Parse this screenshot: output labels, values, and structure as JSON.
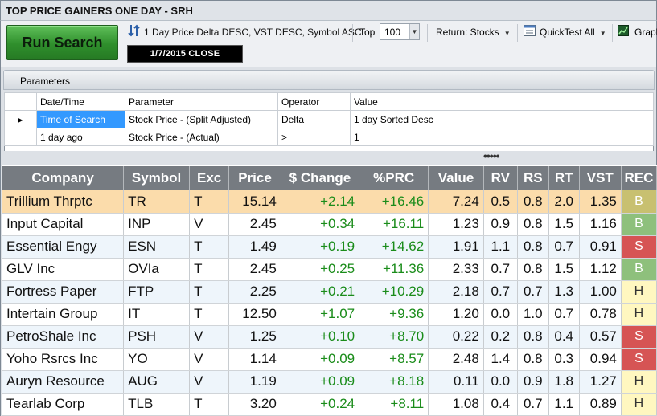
{
  "window": {
    "title": "TOP PRICE GAINERS ONE DAY - SRH"
  },
  "toolbar": {
    "run_label": "Run Search",
    "sort_label": "1 Day Price Delta DESC, VST DESC, Symbol ASC",
    "top_label": "Top",
    "top_value": "100",
    "return_label": "Return: Stocks",
    "quicktest_label": "QuickTest All",
    "graph_label": "Graph",
    "date_label": "1/7/2015  CLOSE"
  },
  "parameters": {
    "title": "Parameters",
    "columns": [
      "Date/Time",
      "Parameter",
      "Operator",
      "Value"
    ],
    "rows": [
      {
        "datetime": "Time of Search",
        "parameter": "Stock Price - (Split Adjusted)",
        "operator": "Delta",
        "value": "1 day Sorted Desc"
      },
      {
        "datetime": "1 day ago",
        "parameter": "Stock Price - (Actual)",
        "operator": ">",
        "value": "1"
      }
    ]
  },
  "splitter": "•••••",
  "results": {
    "columns": [
      "Company",
      "Symbol",
      "Exc",
      "Price",
      "$ Change",
      "%PRC",
      "Value",
      "RV",
      "RS",
      "RT",
      "VST",
      "REC"
    ],
    "rows": [
      {
        "company": "Trillium Thrptc",
        "symbol": "TR",
        "exc": "T",
        "price": "15.14",
        "change": "+2.14",
        "prc": "+16.46",
        "value": "7.24",
        "rv": "0.5",
        "rs": "0.8",
        "rt": "2.0",
        "vst": "1.35",
        "rec": "B"
      },
      {
        "company": "Input Capital",
        "symbol": "INP",
        "exc": "V",
        "price": "2.45",
        "change": "+0.34",
        "prc": "+16.11",
        "value": "1.23",
        "rv": "0.9",
        "rs": "0.8",
        "rt": "1.5",
        "vst": "1.16",
        "rec": "B"
      },
      {
        "company": "Essential Engy",
        "symbol": "ESN",
        "exc": "T",
        "price": "1.49",
        "change": "+0.19",
        "prc": "+14.62",
        "value": "1.91",
        "rv": "1.1",
        "rs": "0.8",
        "rt": "0.7",
        "vst": "0.91",
        "rec": "S"
      },
      {
        "company": "GLV Inc",
        "symbol": "OVIa",
        "exc": "T",
        "price": "2.45",
        "change": "+0.25",
        "prc": "+11.36",
        "value": "2.33",
        "rv": "0.7",
        "rs": "0.8",
        "rt": "1.5",
        "vst": "1.12",
        "rec": "B"
      },
      {
        "company": "Fortress Paper",
        "symbol": "FTP",
        "exc": "T",
        "price": "2.25",
        "change": "+0.21",
        "prc": "+10.29",
        "value": "2.18",
        "rv": "0.7",
        "rs": "0.7",
        "rt": "1.3",
        "vst": "1.00",
        "rec": "H"
      },
      {
        "company": "Intertain Group",
        "symbol": "IT",
        "exc": "T",
        "price": "12.50",
        "change": "+1.07",
        "prc": "+9.36",
        "value": "1.20",
        "rv": "0.0",
        "rs": "1.0",
        "rt": "0.7",
        "vst": "0.78",
        "rec": "H"
      },
      {
        "company": "PetroShale Inc",
        "symbol": "PSH",
        "exc": "V",
        "price": "1.25",
        "change": "+0.10",
        "prc": "+8.70",
        "value": "0.22",
        "rv": "0.2",
        "rs": "0.8",
        "rt": "0.4",
        "vst": "0.57",
        "rec": "S"
      },
      {
        "company": "Yoho Rsrcs Inc",
        "symbol": "YO",
        "exc": "V",
        "price": "1.14",
        "change": "+0.09",
        "prc": "+8.57",
        "value": "2.48",
        "rv": "1.4",
        "rs": "0.8",
        "rt": "0.3",
        "vst": "0.94",
        "rec": "S"
      },
      {
        "company": "Auryn Resource",
        "symbol": "AUG",
        "exc": "V",
        "price": "1.19",
        "change": "+0.09",
        "prc": "+8.18",
        "value": "0.11",
        "rv": "0.0",
        "rs": "0.9",
        "rt": "1.8",
        "vst": "1.27",
        "rec": "H"
      },
      {
        "company": "Tearlab Corp",
        "symbol": "TLB",
        "exc": "T",
        "price": "3.20",
        "change": "+0.24",
        "prc": "+8.11",
        "value": "1.08",
        "rv": "0.4",
        "rs": "0.7",
        "rt": "1.1",
        "vst": "0.89",
        "rec": "H"
      }
    ]
  }
}
